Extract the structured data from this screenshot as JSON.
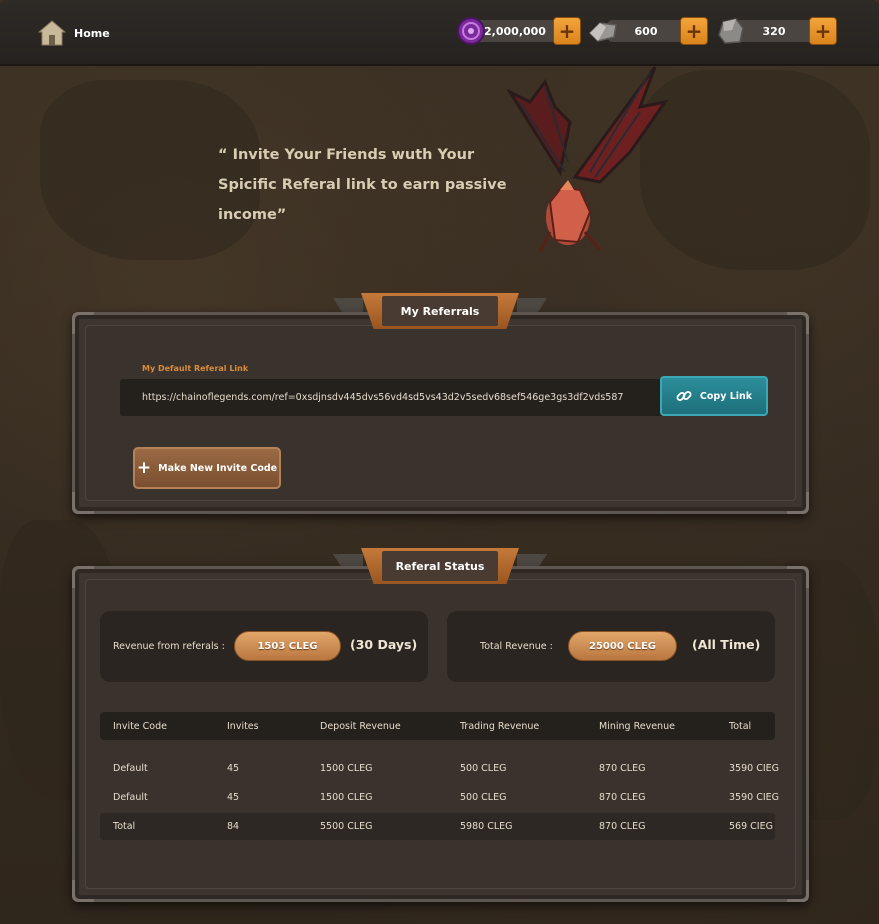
{
  "header": {
    "home_label": "Home",
    "resources": [
      {
        "icon": "purple-gem-icon",
        "value": "2,000,000"
      },
      {
        "icon": "iron-ingot-icon",
        "value": "600"
      },
      {
        "icon": "stone-ore-icon",
        "value": "320"
      }
    ]
  },
  "hero": {
    "quote": "“ Invite Your Friends wuth Your Spicific Referal link to earn passive income”"
  },
  "referrals": {
    "title": "My Referrals",
    "link_label": "My Default Referal Link",
    "link_value": "https://chainoflegends.com/ref=0xsdjnsdv445dvs56vd4sd5vs43d2v5sedv68sef546ge3gs3df2vds587",
    "copy_label": "Copy Link",
    "invite_label": "Make New Invite Code"
  },
  "status": {
    "title": "Referal Status",
    "revenue_label": "Revenue from referals :",
    "revenue_value": "1503 CLEG",
    "revenue_period": "(30 Days)",
    "total_label": "Total Revenue :",
    "total_value": "25000 CLEG",
    "total_period": "(All Time)",
    "table": {
      "headers": [
        "Invite Code",
        "Invites",
        "Deposit Revenue",
        "Trading Revenue",
        "Mining Revenue",
        "Total"
      ],
      "rows": [
        [
          "Default",
          "45",
          "1500 CLEG",
          "500 CLEG",
          "870 CLEG",
          "3590 CIEG"
        ],
        [
          "Default",
          "45",
          "1500 CLEG",
          "500 CLEG",
          "870 CLEG",
          "3590 CIEG"
        ],
        [
          "Total",
          "84",
          "5500 CLEG",
          "5980 CLEG",
          "870 CLEG",
          "569 CIEG"
        ]
      ]
    }
  },
  "colors": {
    "accent_orange": "#d9841c",
    "copy_teal": "#1d6f7a",
    "panel_bg": "#3a332d"
  }
}
